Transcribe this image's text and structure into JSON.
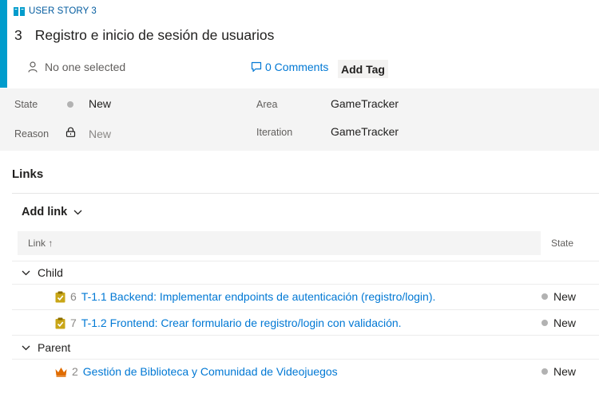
{
  "header": {
    "type_label": "USER STORY 3",
    "id": "3",
    "title": "Registro e inicio de sesión de usuarios",
    "assignee": "No one selected",
    "comments": "0 Comments",
    "add_tag": "Add Tag",
    "accent_color": "#009ccc",
    "icons": {
      "type": "book-icon",
      "assignee": "person-icon",
      "comments": "comment-icon"
    }
  },
  "fields": {
    "state": {
      "label": "State",
      "value": "New"
    },
    "reason": {
      "label": "Reason",
      "value": "New"
    },
    "area": {
      "label": "Area",
      "value": "GameTracker"
    },
    "iteration": {
      "label": "Iteration",
      "value": "GameTracker"
    }
  },
  "links": {
    "heading": "Links",
    "add_link": "Add link",
    "columns": {
      "link": "Link ↑",
      "state": "State"
    },
    "groups": [
      {
        "name": "Child",
        "items": [
          {
            "id": "6",
            "title": "T-1.1 Backend: Implementar endpoints de autenticación (registro/login).",
            "state": "New",
            "icon": "task-icon",
            "icon_color": "#a4880a"
          },
          {
            "id": "7",
            "title": "T-1.2 Frontend: Crear formulario de registro/login con validación.",
            "state": "New",
            "icon": "task-icon",
            "icon_color": "#a4880a"
          }
        ]
      },
      {
        "name": "Parent",
        "items": [
          {
            "id": "2",
            "title": "Gestión de Biblioteca y Comunidad de Videojuegos",
            "state": "New",
            "icon": "epic-crown-icon",
            "icon_color": "#e06c00"
          }
        ]
      }
    ]
  }
}
